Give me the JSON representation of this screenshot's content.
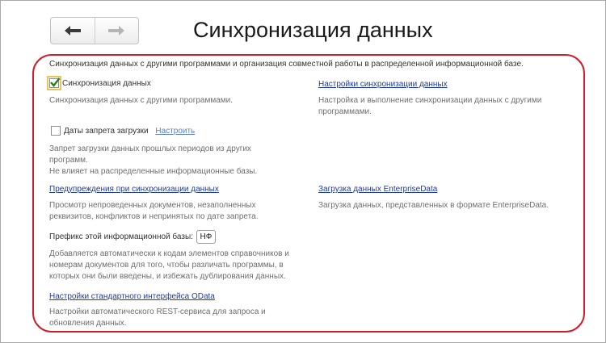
{
  "header": {
    "title": "Синхронизация данных",
    "back_icon": "arrow-left",
    "forward_icon": "arrow-right"
  },
  "main": {
    "description": "Синхронизация данных с другими программами и организация совместной работы в распределенной информационной базе.",
    "sync": {
      "label": "Синхронизация данных",
      "checked": true,
      "hint": "Синхронизация данных с другими программами."
    },
    "sync_settings": {
      "link": "Настройки синхронизации данных",
      "hint_lines": [
        "Настройка и выполнение синхронизации данных с другими",
        "программами."
      ]
    },
    "ban_dates": {
      "label": "Даты запрета загрузки",
      "checked": false,
      "configure_link": "Настроить",
      "hint_lines": [
        "Запрет загрузки данных прошлых периодов из других",
        "программ.",
        "Не влияет на распределенные информационные базы."
      ]
    },
    "warnings": {
      "link": "Предупреждения при синхронизации данных",
      "hint_lines": [
        "Просмотр непроведенных документов, незаполненных",
        "реквизитов, конфликтов и непринятых по дате запрета."
      ]
    },
    "enterprise": {
      "link": "Загрузка данных EnterpriseData",
      "hint": "Загрузка данных, представленных в формате EnterpriseData."
    },
    "prefix": {
      "label": "Префикс этой информационной базы:",
      "value": "НФ",
      "hint_lines": [
        "Добавляется автоматически к кодам элементов справочников и",
        "номерам документов для того, чтобы различать программы, в",
        "которых они были введены, и избежать дублирования данных."
      ]
    },
    "odata": {
      "link": "Настройки стандартного интерфейса OData",
      "hint_lines": [
        "Настройки автоматического REST-сервиса для запроса и",
        "обновления данных."
      ]
    }
  },
  "colors": {
    "highlight": "#cc1f2b",
    "link": "#1f3aa0"
  }
}
